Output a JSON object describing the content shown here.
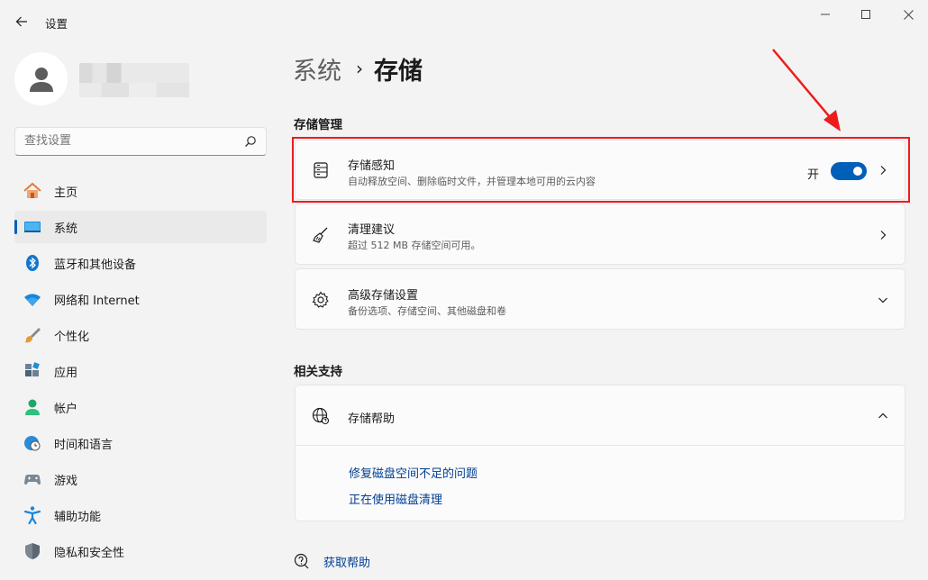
{
  "window": {
    "title": "设置"
  },
  "search": {
    "placeholder": "查找设置"
  },
  "sidebar": {
    "items": [
      {
        "label": "主页",
        "icon": "home-icon"
      },
      {
        "label": "系统",
        "icon": "system-display-icon",
        "active": true
      },
      {
        "label": "蓝牙和其他设备",
        "icon": "bluetooth-icon"
      },
      {
        "label": "网络和 Internet",
        "icon": "wifi-icon"
      },
      {
        "label": "个性化",
        "icon": "brush-icon"
      },
      {
        "label": "应用",
        "icon": "apps-icon"
      },
      {
        "label": "帐户",
        "icon": "account-icon"
      },
      {
        "label": "时间和语言",
        "icon": "clock-globe-icon"
      },
      {
        "label": "游戏",
        "icon": "gamepad-icon"
      },
      {
        "label": "辅助功能",
        "icon": "accessibility-icon"
      },
      {
        "label": "隐私和安全性",
        "icon": "shield-icon"
      }
    ]
  },
  "breadcrumb": {
    "parent": "系统",
    "separator": "›",
    "current": "存储"
  },
  "storage_management": {
    "title": "存储管理",
    "items": [
      {
        "title": "存储感知",
        "subtitle": "自动释放空间、删除临时文件，并管理本地可用的云内容",
        "toggle_label": "开",
        "toggle_on": true
      },
      {
        "title": "清理建议",
        "subtitle": "超过 512 MB 存储空间可用。"
      },
      {
        "title": "高级存储设置",
        "subtitle": "备份选项、存储空间、其他磁盘和卷"
      }
    ]
  },
  "related_support": {
    "title": "相关支持",
    "help_title": "存储帮助",
    "links": [
      "修复磁盘空间不足的问题",
      "正在使用磁盘清理"
    ]
  },
  "footer": {
    "get_help": "获取帮助"
  },
  "colors": {
    "accent": "#005fb8",
    "highlight": "#ee1c1c",
    "link": "#003e92"
  }
}
